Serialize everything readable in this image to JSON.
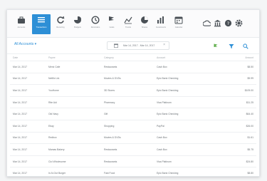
{
  "toolbar": {
    "tools": [
      {
        "icon": "briefcase-icon",
        "label": "Accounts"
      },
      {
        "icon": "list-icon",
        "label": "Transactions"
      },
      {
        "icon": "refresh-icon",
        "label": "Recurring"
      },
      {
        "icon": "pie-icon",
        "label": "Budgets"
      },
      {
        "icon": "clock-icon",
        "label": "Reminders"
      },
      {
        "icon": "flag-icon",
        "label": "Goals"
      },
      {
        "icon": "trend-icon",
        "label": "Trends"
      },
      {
        "icon": "pie-chart-icon",
        "label": "Shares"
      },
      {
        "icon": "bar-chart-icon",
        "label": "Investments"
      },
      {
        "icon": "calendar-icon",
        "label": "Calendar"
      }
    ],
    "active_label": "Transactions"
  },
  "filter": {
    "account_select": "All Accounts ▾",
    "date_range": "Mar 14, 2017 - Mar 14, 2017",
    "clear": "×"
  },
  "table": {
    "headers": [
      "Date",
      "Payee",
      "Category",
      "Account",
      "Amount"
    ],
    "rows": [
      [
        "Mar 14, 2017",
        "Merci Cafe",
        "Restaurants",
        "Cash Box",
        "$8.50"
      ],
      [
        "Mar 14, 2017",
        "Netflix Ltd.",
        "Movies & DVDs",
        "Epic Bank Checking",
        "$9.99"
      ],
      [
        "Mar 14, 2017",
        "YouHome",
        "3D Stores",
        "Epic Bank Checking",
        "$109.00"
      ],
      [
        "Mar 14, 2017",
        "Rite Aid",
        "Pharmacy",
        "Visa Platinum",
        "$11.25"
      ],
      [
        "Mar 14, 2017",
        "Old Navy",
        "Gift",
        "Epic Bank Checking",
        "$64.40"
      ],
      [
        "Mar 14, 2017",
        "Ebay",
        "Shopping",
        "PayPal",
        "$26.00"
      ],
      [
        "Mar 14, 2017",
        "Redbox",
        "Movies & DVDs",
        "Cash Box",
        "$1.61"
      ],
      [
        "Mar 14, 2017",
        "Mamas Bakery",
        "Restaurants",
        "Cash Box",
        "$5.75"
      ],
      [
        "Mar 14, 2017",
        "Cici Wholesome",
        "Restaurants",
        "Visa Platinum",
        "$24.80"
      ],
      [
        "Mar 14, 2017",
        "In-N-Out Burger",
        "Fast Food",
        "Epic Bank Checking",
        "$8.80"
      ]
    ]
  }
}
